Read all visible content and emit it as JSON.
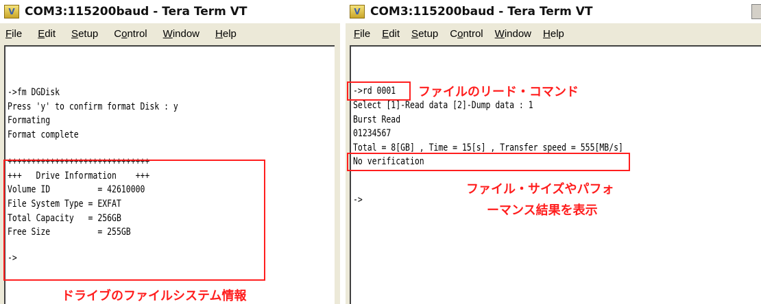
{
  "left_window": {
    "icon_glyph": "V",
    "title": "COM3:115200baud - Tera Term VT",
    "menu": [
      {
        "label": "File",
        "u": "F",
        "rest": "ile"
      },
      {
        "label": "Edit",
        "u": "E",
        "rest": "dit"
      },
      {
        "label": "Setup",
        "u": "S",
        "rest": "etup"
      },
      {
        "label": "Control",
        "pre": "C",
        "u": "o",
        "rest": "ntrol"
      },
      {
        "label": "Window",
        "u": "W",
        "rest": "indow"
      },
      {
        "label": "Help",
        "u": "H",
        "rest": "elp"
      }
    ],
    "terminal_lines": [
      "->fm DGDisk",
      "Press 'y' to confirm format Disk : y",
      "Formating",
      "Format complete",
      "",
      "++++++++++++++++++++++++++++++",
      "+++   Drive Information    +++",
      "Volume ID          = 42610000",
      "File System Type = EXFAT",
      "Total Capacity   = 256GB",
      "Free Size          = 255GB",
      "",
      "->"
    ],
    "annotation": "ドライブのファイルシステム情報"
  },
  "right_window": {
    "icon_glyph": "V",
    "title": "COM3:115200baud - Tera Term VT",
    "menu": [
      {
        "label": "File",
        "u": "F",
        "rest": "ile"
      },
      {
        "label": "Edit",
        "u": "E",
        "rest": "dit"
      },
      {
        "label": "Setup",
        "u": "S",
        "rest": "etup"
      },
      {
        "label": "Control",
        "pre": "C",
        "u": "o",
        "rest": "ntrol"
      },
      {
        "label": "Window",
        "u": "W",
        "rest": "indow"
      },
      {
        "label": "Help",
        "u": "H",
        "rest": "elp"
      }
    ],
    "terminal_lines": [
      "->rd 0001",
      "Select [1]-Read data [2]-Dump data : 1",
      "Burst Read",
      "01234567",
      "Total = 8[GB] , Time = 15[s] , Transfer speed = 555[MB/s]",
      "No verification",
      "",
      "",
      "->"
    ],
    "annotation_command": "ファイルのリード・コマンド",
    "annotation_result_line1": "ファイル・サイズやパフォ",
    "annotation_result_line2": "ーマンス結果を表示"
  },
  "colors": {
    "annotation_red": "#ff1e1e",
    "window_bg": "#ece9d8",
    "terminal_bg": "#ffffff"
  }
}
